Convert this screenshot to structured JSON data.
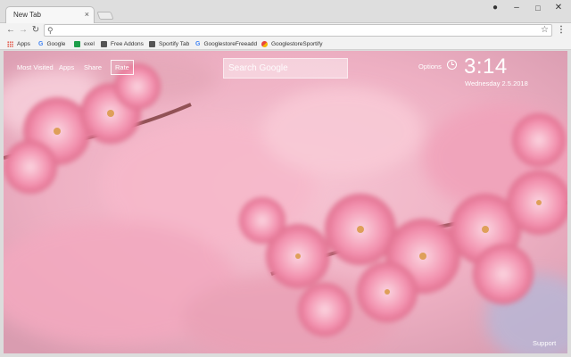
{
  "browser": {
    "tab_title": "New Tab",
    "tab_close": "×",
    "window_controls": {
      "profile": "●",
      "minimize": "–",
      "maximize": "□",
      "close": "✕"
    },
    "nav": {
      "back": "←",
      "forward": "→",
      "reload": "↻",
      "menu": "⋮"
    },
    "omnibox": {
      "search_glyph": "⚲",
      "value": "",
      "bookmark_glyph": "☆"
    },
    "bookmarks": [
      {
        "label": "Apps",
        "icon": "apps-grid-icon"
      },
      {
        "label": "Google",
        "icon": "google-g-icon"
      },
      {
        "label": "exel",
        "icon": "sheets-icon"
      },
      {
        "label": "Free Addons",
        "icon": "page-icon"
      },
      {
        "label": "Sportify Tab",
        "icon": "page-icon"
      },
      {
        "label": "GooglestoreFreeadd",
        "icon": "google-g-icon"
      },
      {
        "label": "GooglestoreSportify",
        "icon": "drive-icon"
      }
    ],
    "g_glyph": "G"
  },
  "newtab": {
    "links": {
      "most_visited": "Most Visited",
      "apps": "Apps",
      "share": "Share",
      "rate": "Rate",
      "options": "Options",
      "support": "Support"
    },
    "search": {
      "placeholder": "Search Google"
    },
    "clock": {
      "time": "3:14",
      "date": "Wednesday  2.5.2018"
    },
    "background": "pink cherry blossom photo"
  },
  "colors": {
    "page_text": "#ffffff",
    "blossom": "#f08aa8",
    "blossom_light": "#f9c4d3",
    "blossom_center": "#e0a03a"
  }
}
